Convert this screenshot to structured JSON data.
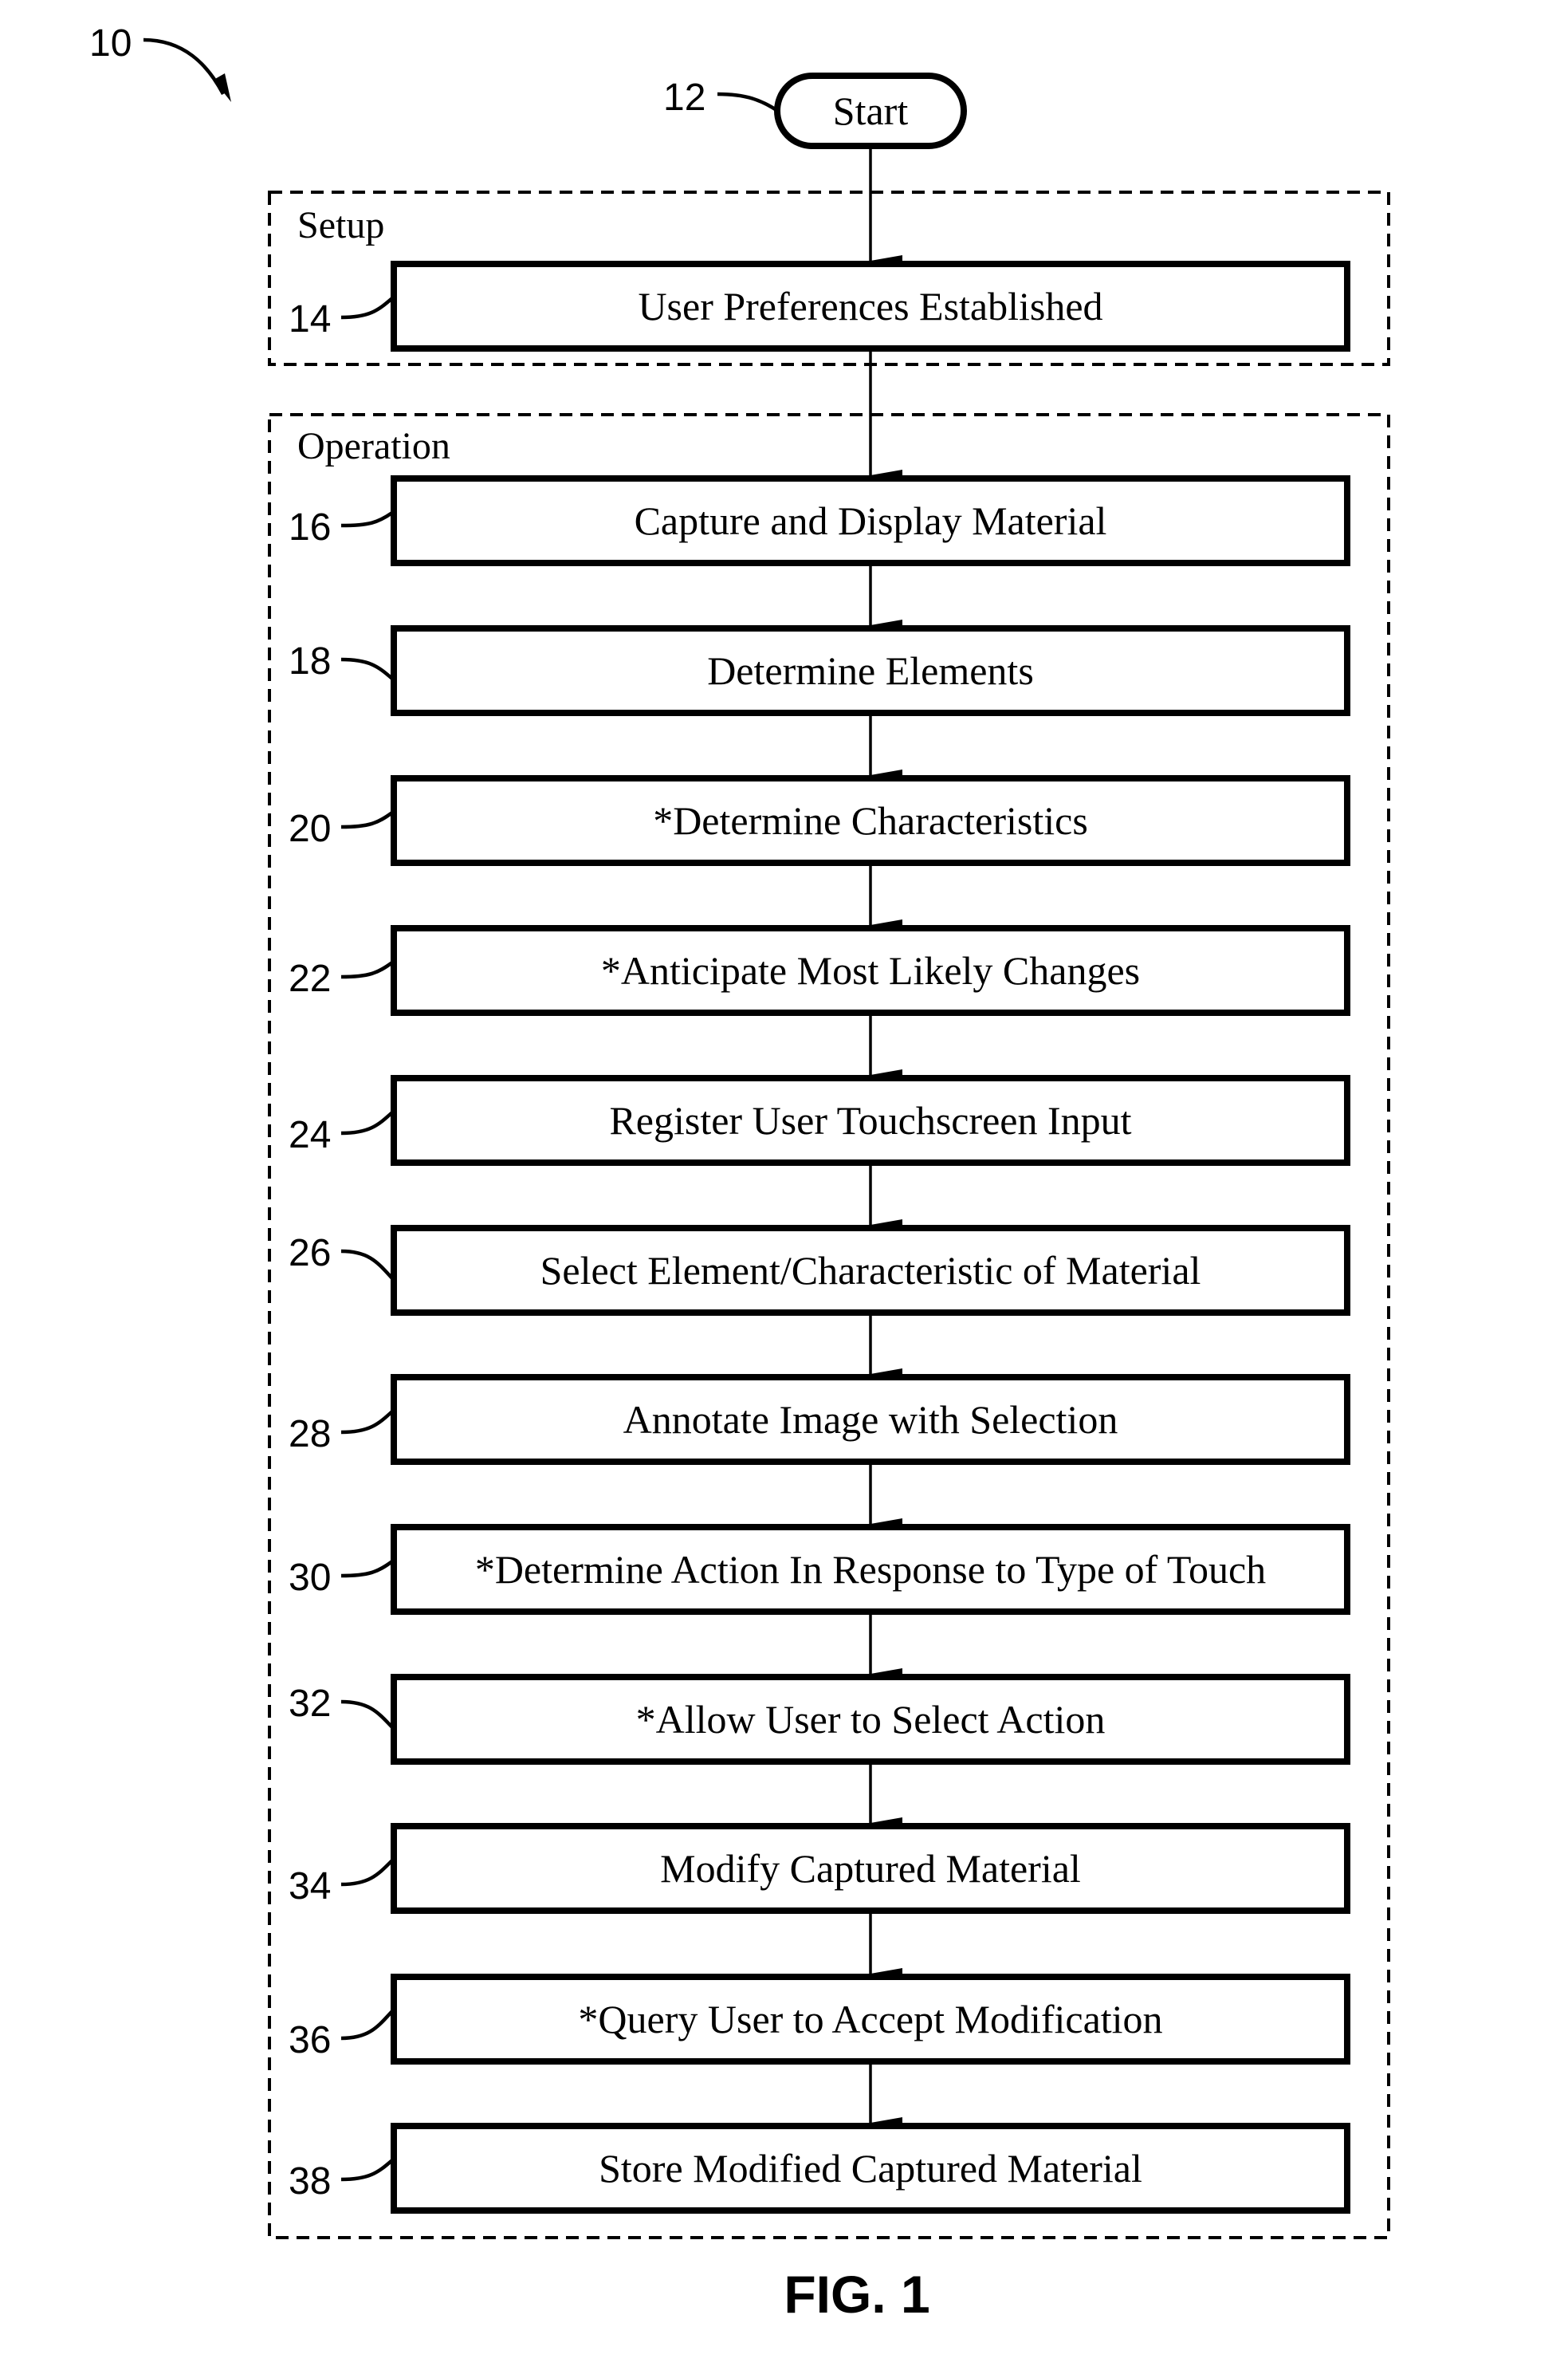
{
  "figure": {
    "reference": "10",
    "title": "FIG. 1"
  },
  "start": {
    "reference": "12",
    "label": "Start"
  },
  "groups": [
    {
      "label": "Setup",
      "steps": [
        {
          "reference": "14",
          "label": "User Preferences Established"
        }
      ]
    },
    {
      "label": "Operation",
      "steps": [
        {
          "reference": "16",
          "label": "Capture and Display Material"
        },
        {
          "reference": "18",
          "label": "Determine Elements"
        },
        {
          "reference": "20",
          "label": "*Determine Characteristics"
        },
        {
          "reference": "22",
          "label": "*Anticipate Most Likely Changes"
        },
        {
          "reference": "24",
          "label": "Register User Touchscreen Input"
        },
        {
          "reference": "26",
          "label": "Select Element/Characteristic of Material"
        },
        {
          "reference": "28",
          "label": "Annotate Image with Selection"
        },
        {
          "reference": "30",
          "label": "*Determine Action In Response to Type of Touch"
        },
        {
          "reference": "32",
          "label": "*Allow User to Select Action"
        },
        {
          "reference": "34",
          "label": "Modify Captured Material"
        },
        {
          "reference": "36",
          "label": "*Query User to Accept Modification"
        },
        {
          "reference": "38",
          "label": "Store Modified Captured Material"
        }
      ]
    }
  ]
}
